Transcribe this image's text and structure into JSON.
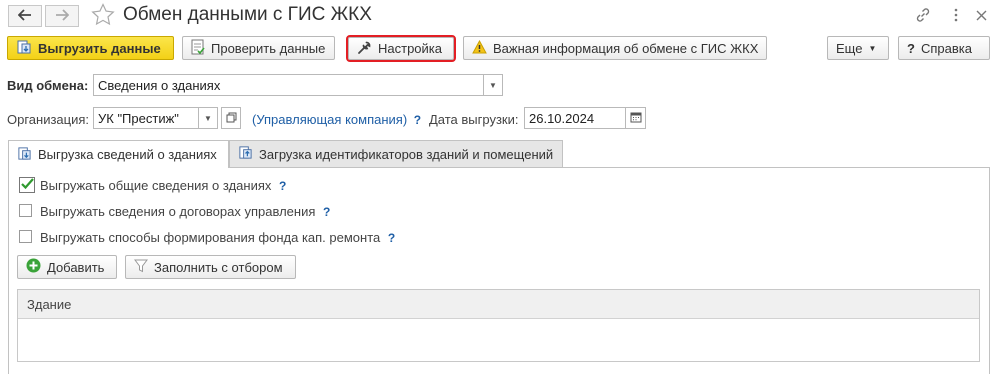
{
  "header": {
    "title": "Обмен данными с ГИС ЖКХ",
    "back_icon": "arrow-left",
    "forward_icon": "arrow-right",
    "favorite_icon": "star-outline"
  },
  "toolbar": {
    "upload_label": "Выгрузить данные",
    "check_label": "Проверить данные",
    "settings_label": "Настройка",
    "important_label": "Важная информация об обмене с ГИС ЖКХ",
    "more_label": "Еще",
    "help_label": "Справка",
    "help_prefix": "?"
  },
  "form": {
    "exchange_type_label": "Вид обмена:",
    "exchange_type_value": "Сведения о зданиях",
    "organization_label": "Организация:",
    "organization_value": "УК \"Престиж\"",
    "organization_role": "(Управляющая компания)",
    "question_mark": "?",
    "upload_date_label": "Дата выгрузки:",
    "upload_date_value": "26.10.2024"
  },
  "tabs": [
    {
      "label": "Выгрузка сведений о зданиях"
    },
    {
      "label": "Загрузка идентификаторов зданий и помещений"
    }
  ],
  "options": [
    {
      "label": "Выгружать общие сведения о зданиях",
      "checked": true,
      "help": "?"
    },
    {
      "label": "Выгружать сведения о договорах управления",
      "checked": false,
      "help": "?"
    },
    {
      "label": "Выгружать способы формирования фонда кап. ремонта",
      "checked": false,
      "help": "?"
    }
  ],
  "table_toolbar": {
    "add_label": "Добавить",
    "fill_label": "Заполнить с отбором"
  },
  "table": {
    "columns": [
      "Здание"
    ]
  },
  "colors": {
    "primary_yellow": "#f3d117",
    "highlight_red": "#e31e24",
    "link_blue": "#1f5fa6",
    "add_green": "#3aa339"
  }
}
